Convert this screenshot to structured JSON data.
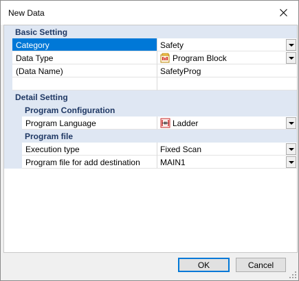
{
  "window": {
    "title": "New Data"
  },
  "basic_setting": {
    "header": "Basic Setting",
    "rows": [
      {
        "name": "Category",
        "value": "Safety",
        "has_dropdown": true,
        "selected": true
      },
      {
        "name": "Data Type",
        "value": "Program Block",
        "icon": "program-block-icon",
        "has_dropdown": true
      },
      {
        "name": "(Data Name)",
        "value": "SafetyProg"
      },
      {
        "name": "",
        "value": ""
      }
    ]
  },
  "detail_setting": {
    "header": "Detail Setting",
    "program_configuration": {
      "header": "Program Configuration",
      "rows": [
        {
          "name": "Program Language",
          "value": "Ladder",
          "icon": "ladder-icon",
          "has_dropdown": true
        }
      ]
    },
    "program_file": {
      "header": "Program file",
      "rows": [
        {
          "name": "Execution type",
          "value": "Fixed Scan",
          "has_dropdown": true
        },
        {
          "name": "Program file for add destination",
          "value": "MAIN1",
          "has_dropdown": true
        }
      ]
    }
  },
  "buttons": {
    "ok": "OK",
    "cancel": "Cancel"
  },
  "colors": {
    "selection": "#0078d7",
    "category_bg": "#dfe7f3",
    "category_text": "#1f3864"
  }
}
